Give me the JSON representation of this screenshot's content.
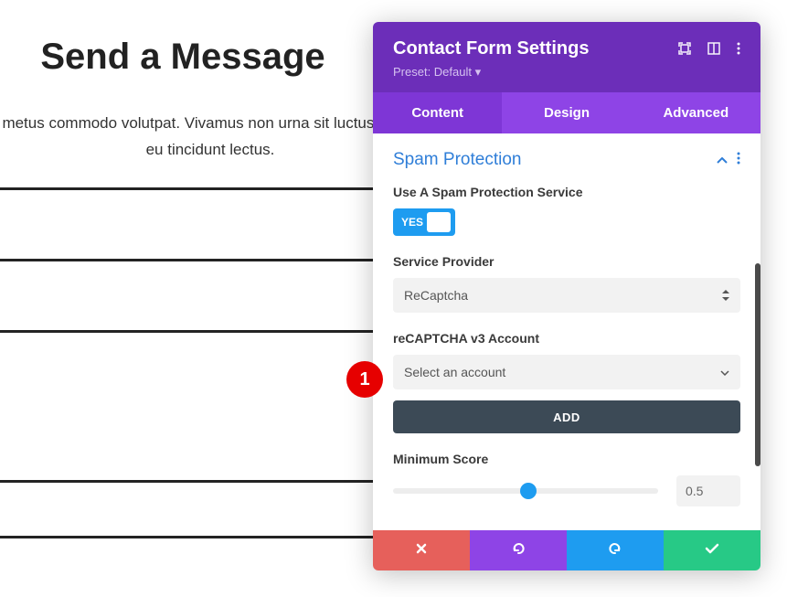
{
  "page": {
    "title": "Send a Message",
    "body_text": "metus commodo volutpat. Vivamus non urna sit luctus. Nulla eu tincidunt lectus."
  },
  "panel": {
    "title": "Contact Form Settings",
    "preset_label": "Preset: Default ▾"
  },
  "tabs": {
    "content": "Content",
    "design": "Design",
    "advanced": "Advanced"
  },
  "section": {
    "title": "Spam Protection"
  },
  "fields": {
    "use_spam_label": "Use A Spam Protection Service",
    "toggle_text": "YES",
    "provider_label": "Service Provider",
    "provider_value": "ReCaptcha",
    "account_label": "reCAPTCHA v3 Account",
    "account_value": "Select an account",
    "add_button": "ADD",
    "min_score_label": "Minimum Score",
    "min_score_value": "0.5"
  },
  "badge": {
    "number": "1"
  }
}
